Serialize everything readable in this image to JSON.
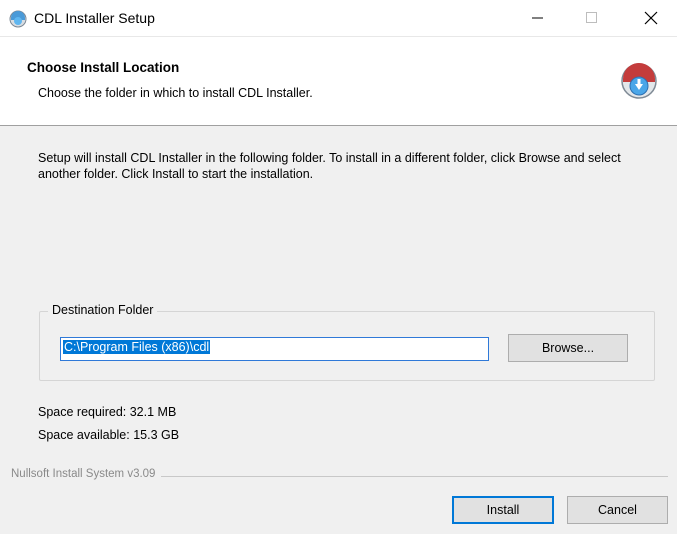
{
  "window": {
    "title": "CDL Installer Setup",
    "controls": {
      "minimize": "minimize-icon",
      "maximize": "maximize-icon",
      "close": "close-icon"
    }
  },
  "header": {
    "title": "Choose Install Location",
    "subtitle": "Choose the folder in which to install CDL Installer.",
    "icon": "installer-globe-icon"
  },
  "body": {
    "intro": "Setup will install CDL Installer in the following folder. To install in a different folder, click Browse and select another folder. Click Install to start the installation.",
    "destination_group_label": "Destination Folder",
    "destination_path": "C:\\Program Files (x86)\\cdl",
    "browse_label": "Browse...",
    "space_required": "Space required: 32.1 MB",
    "space_available": "Space available: 15.3 GB"
  },
  "footer": {
    "branding": "Nullsoft Install System v3.09",
    "install_label": "Install",
    "cancel_label": "Cancel"
  },
  "colors": {
    "accent": "#0078d7",
    "background": "#f0f0f0",
    "header_bg": "#ffffff"
  }
}
